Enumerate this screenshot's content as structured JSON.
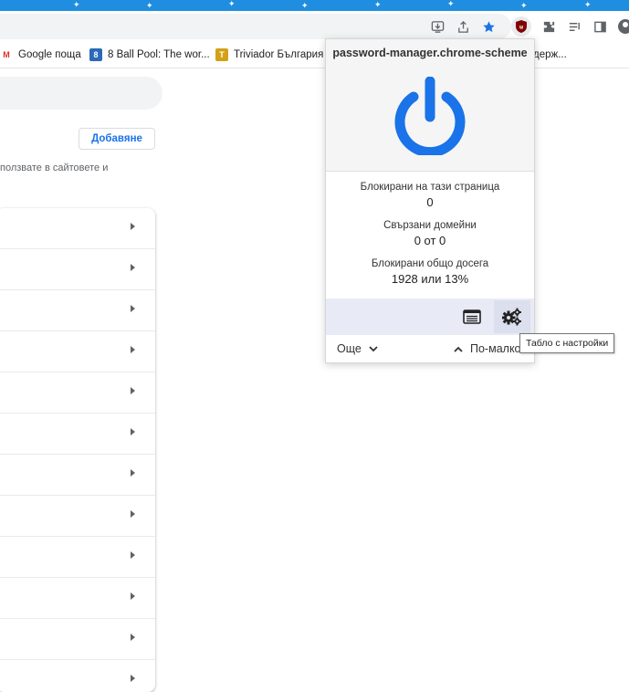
{
  "bookmarks": [
    {
      "label": "Google поща",
      "icon": "gmail-icon"
    },
    {
      "label": "8 Ball Pool: The wor...",
      "icon": "8ball-icon"
    },
    {
      "label": "Triviador България",
      "icon": "triviador-icon"
    },
    {
      "label": "держ...",
      "icon": ""
    }
  ],
  "page": {
    "add_button": "Добавяне",
    "description": "ползвате в сайтовете и",
    "rows": 12
  },
  "popup": {
    "domain": "password-manager.chrome-scheme",
    "power_color": "#1a73e8",
    "stats": [
      {
        "label": "Блокирани на тази страница",
        "value": "0"
      },
      {
        "label": "Свързани домейни",
        "value": "0 от 0"
      },
      {
        "label": "Блокирани общо досега",
        "value": "1928 или 13%"
      }
    ],
    "more": "Още",
    "less": "По-малко"
  },
  "tooltip": "Табло с настройки",
  "colors": {
    "tabstrip": "#1f8ee0",
    "accent": "#1a73e8",
    "ublock": "#800000"
  }
}
